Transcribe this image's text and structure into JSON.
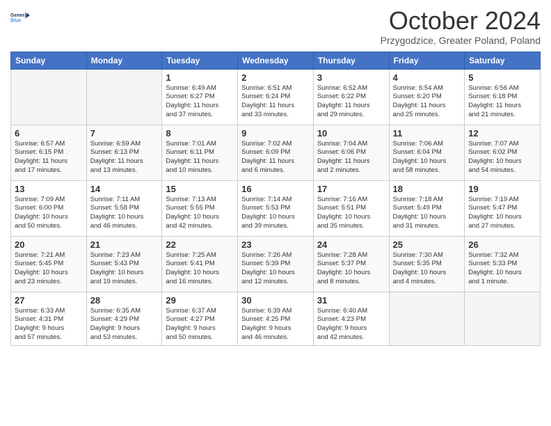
{
  "header": {
    "logo_line1": "General",
    "logo_line2": "Blue",
    "month": "October 2024",
    "location": "Przygodzice, Greater Poland, Poland"
  },
  "days_of_week": [
    "Sunday",
    "Monday",
    "Tuesday",
    "Wednesday",
    "Thursday",
    "Friday",
    "Saturday"
  ],
  "weeks": [
    [
      {
        "day": "",
        "info": ""
      },
      {
        "day": "",
        "info": ""
      },
      {
        "day": "1",
        "info": "Sunrise: 6:49 AM\nSunset: 6:27 PM\nDaylight: 11 hours\nand 37 minutes."
      },
      {
        "day": "2",
        "info": "Sunrise: 6:51 AM\nSunset: 6:24 PM\nDaylight: 11 hours\nand 33 minutes."
      },
      {
        "day": "3",
        "info": "Sunrise: 6:52 AM\nSunset: 6:22 PM\nDaylight: 11 hours\nand 29 minutes."
      },
      {
        "day": "4",
        "info": "Sunrise: 6:54 AM\nSunset: 6:20 PM\nDaylight: 11 hours\nand 25 minutes."
      },
      {
        "day": "5",
        "info": "Sunrise: 6:56 AM\nSunset: 6:18 PM\nDaylight: 11 hours\nand 21 minutes."
      }
    ],
    [
      {
        "day": "6",
        "info": "Sunrise: 6:57 AM\nSunset: 6:15 PM\nDaylight: 11 hours\nand 17 minutes."
      },
      {
        "day": "7",
        "info": "Sunrise: 6:59 AM\nSunset: 6:13 PM\nDaylight: 11 hours\nand 13 minutes."
      },
      {
        "day": "8",
        "info": "Sunrise: 7:01 AM\nSunset: 6:11 PM\nDaylight: 11 hours\nand 10 minutes."
      },
      {
        "day": "9",
        "info": "Sunrise: 7:02 AM\nSunset: 6:09 PM\nDaylight: 11 hours\nand 6 minutes."
      },
      {
        "day": "10",
        "info": "Sunrise: 7:04 AM\nSunset: 6:06 PM\nDaylight: 11 hours\nand 2 minutes."
      },
      {
        "day": "11",
        "info": "Sunrise: 7:06 AM\nSunset: 6:04 PM\nDaylight: 10 hours\nand 58 minutes."
      },
      {
        "day": "12",
        "info": "Sunrise: 7:07 AM\nSunset: 6:02 PM\nDaylight: 10 hours\nand 54 minutes."
      }
    ],
    [
      {
        "day": "13",
        "info": "Sunrise: 7:09 AM\nSunset: 6:00 PM\nDaylight: 10 hours\nand 50 minutes."
      },
      {
        "day": "14",
        "info": "Sunrise: 7:11 AM\nSunset: 5:58 PM\nDaylight: 10 hours\nand 46 minutes."
      },
      {
        "day": "15",
        "info": "Sunrise: 7:13 AM\nSunset: 5:55 PM\nDaylight: 10 hours\nand 42 minutes."
      },
      {
        "day": "16",
        "info": "Sunrise: 7:14 AM\nSunset: 5:53 PM\nDaylight: 10 hours\nand 39 minutes."
      },
      {
        "day": "17",
        "info": "Sunrise: 7:16 AM\nSunset: 5:51 PM\nDaylight: 10 hours\nand 35 minutes."
      },
      {
        "day": "18",
        "info": "Sunrise: 7:18 AM\nSunset: 5:49 PM\nDaylight: 10 hours\nand 31 minutes."
      },
      {
        "day": "19",
        "info": "Sunrise: 7:19 AM\nSunset: 5:47 PM\nDaylight: 10 hours\nand 27 minutes."
      }
    ],
    [
      {
        "day": "20",
        "info": "Sunrise: 7:21 AM\nSunset: 5:45 PM\nDaylight: 10 hours\nand 23 minutes."
      },
      {
        "day": "21",
        "info": "Sunrise: 7:23 AM\nSunset: 5:43 PM\nDaylight: 10 hours\nand 19 minutes."
      },
      {
        "day": "22",
        "info": "Sunrise: 7:25 AM\nSunset: 5:41 PM\nDaylight: 10 hours\nand 16 minutes."
      },
      {
        "day": "23",
        "info": "Sunrise: 7:26 AM\nSunset: 5:39 PM\nDaylight: 10 hours\nand 12 minutes."
      },
      {
        "day": "24",
        "info": "Sunrise: 7:28 AM\nSunset: 5:37 PM\nDaylight: 10 hours\nand 8 minutes."
      },
      {
        "day": "25",
        "info": "Sunrise: 7:30 AM\nSunset: 5:35 PM\nDaylight: 10 hours\nand 4 minutes."
      },
      {
        "day": "26",
        "info": "Sunrise: 7:32 AM\nSunset: 5:33 PM\nDaylight: 10 hours\nand 1 minute."
      }
    ],
    [
      {
        "day": "27",
        "info": "Sunrise: 6:33 AM\nSunset: 4:31 PM\nDaylight: 9 hours\nand 57 minutes."
      },
      {
        "day": "28",
        "info": "Sunrise: 6:35 AM\nSunset: 4:29 PM\nDaylight: 9 hours\nand 53 minutes."
      },
      {
        "day": "29",
        "info": "Sunrise: 6:37 AM\nSunset: 4:27 PM\nDaylight: 9 hours\nand 50 minutes."
      },
      {
        "day": "30",
        "info": "Sunrise: 6:39 AM\nSunset: 4:25 PM\nDaylight: 9 hours\nand 46 minutes."
      },
      {
        "day": "31",
        "info": "Sunrise: 6:40 AM\nSunset: 4:23 PM\nDaylight: 9 hours\nand 42 minutes."
      },
      {
        "day": "",
        "info": ""
      },
      {
        "day": "",
        "info": ""
      }
    ]
  ]
}
